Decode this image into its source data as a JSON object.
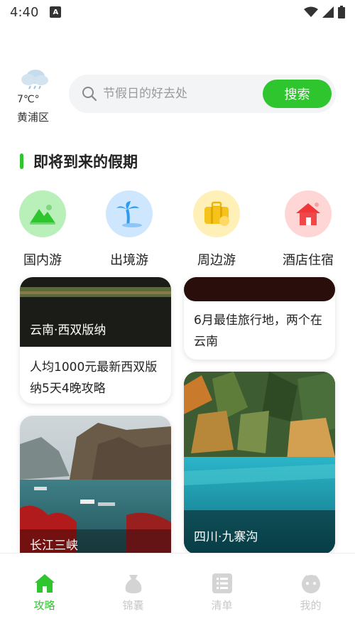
{
  "status_bar": {
    "time": "4:40",
    "notification": "A"
  },
  "weather": {
    "temp": "7℃°",
    "district": "黄浦区",
    "icon": "cloud-rain-icon"
  },
  "search": {
    "placeholder": "节假日的好去处",
    "button_label": "搜索"
  },
  "section": {
    "title": "即将到来的假期"
  },
  "categories": [
    {
      "label": "国内游",
      "icon": "mountain-icon",
      "color": "#b9f0b9"
    },
    {
      "label": "出境游",
      "icon": "palm-tree-icon",
      "color": "#cfe6ff"
    },
    {
      "label": "周边游",
      "icon": "suitcase-icon",
      "color": "#fff0b8"
    },
    {
      "label": "酒店住宿",
      "icon": "house-icon",
      "color": "#ffd6d6"
    }
  ],
  "cards": [
    {
      "title": "云南·西双版纳",
      "desc": "人均1000元最新西双版纳5天4晚攻略"
    },
    {
      "title": "",
      "desc": "6月最佳旅行地，两个在云南"
    },
    {
      "title": "长江三峡",
      "desc": ""
    },
    {
      "title": "四川·九寨沟",
      "desc": ""
    }
  ],
  "tabs": [
    {
      "label": "攻略",
      "icon": "home-icon",
      "active": true
    },
    {
      "label": "锦囊",
      "icon": "bag-icon",
      "active": false
    },
    {
      "label": "清单",
      "icon": "list-icon",
      "active": false
    },
    {
      "label": "我的",
      "icon": "profile-icon",
      "active": false
    }
  ],
  "colors": {
    "accent": "#2fc52f"
  }
}
